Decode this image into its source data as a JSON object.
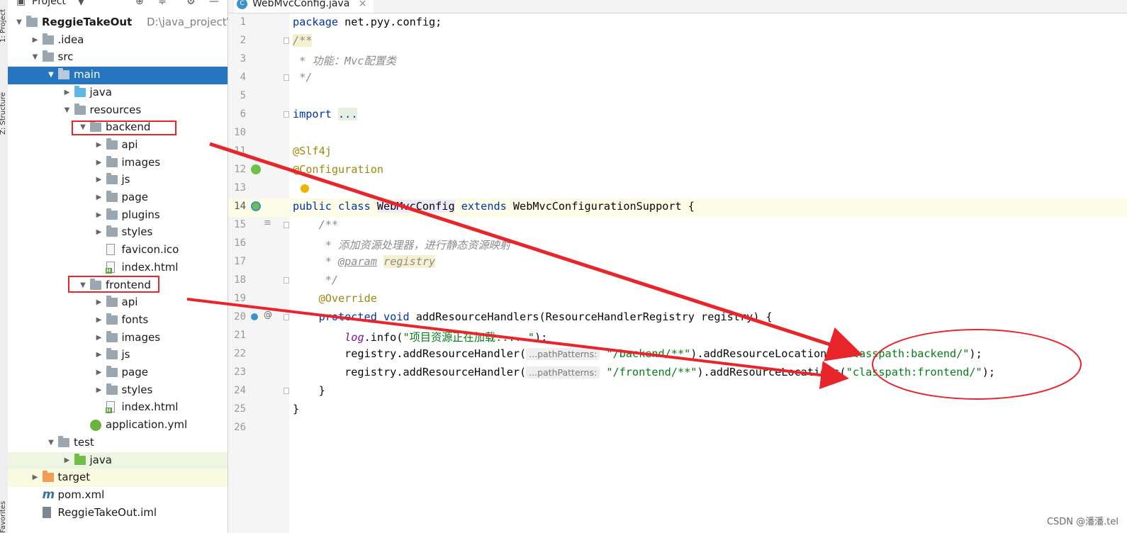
{
  "sidebar_tabs": {
    "project": "1: Project",
    "structure": "Z: Structure",
    "favorites": "Favorites"
  },
  "project_panel": {
    "header_label": "Project",
    "tree": [
      {
        "label": "ReggieTakeOut",
        "path": "D:\\java_project\\Reg",
        "bold": true,
        "icon": "module-folder",
        "expanded": true
      },
      {
        "label": ".idea",
        "icon": "folder",
        "expanded": false
      },
      {
        "label": "src",
        "icon": "folder",
        "expanded": true
      },
      {
        "label": "main",
        "icon": "folder",
        "expanded": true,
        "selected": true
      },
      {
        "label": "java",
        "icon": "source-folder",
        "expanded": false
      },
      {
        "label": "resources",
        "icon": "resources-folder",
        "expanded": true
      },
      {
        "label": "backend",
        "icon": "folder",
        "expanded": true,
        "highlighted": true
      },
      {
        "label": "api",
        "icon": "folder",
        "expanded": false
      },
      {
        "label": "images",
        "icon": "folder",
        "expanded": false
      },
      {
        "label": "js",
        "icon": "folder",
        "expanded": false
      },
      {
        "label": "page",
        "icon": "folder",
        "expanded": false
      },
      {
        "label": "plugins",
        "icon": "folder",
        "expanded": false
      },
      {
        "label": "styles",
        "icon": "folder",
        "expanded": false
      },
      {
        "label": "favicon.ico",
        "icon": "file-icon"
      },
      {
        "label": "index.html",
        "icon": "html-file-icon"
      },
      {
        "label": "frontend",
        "icon": "folder",
        "expanded": true,
        "highlighted": true
      },
      {
        "label": "api",
        "icon": "folder",
        "expanded": false
      },
      {
        "label": "fonts",
        "icon": "folder",
        "expanded": false
      },
      {
        "label": "images",
        "icon": "folder",
        "expanded": false
      },
      {
        "label": "js",
        "icon": "folder",
        "expanded": false
      },
      {
        "label": "page",
        "icon": "folder",
        "expanded": false
      },
      {
        "label": "styles",
        "icon": "folder",
        "expanded": false
      },
      {
        "label": "index.html",
        "icon": "html-file-icon"
      },
      {
        "label": "application.yml",
        "icon": "yml-file-icon"
      },
      {
        "label": "test",
        "icon": "folder",
        "expanded": true
      },
      {
        "label": "java",
        "icon": "test-source-folder",
        "expanded": false
      },
      {
        "label": "target",
        "icon": "excluded-folder",
        "expanded": false
      },
      {
        "label": "pom.xml",
        "icon": "maven-icon"
      },
      {
        "label": "ReggieTakeOut.iml",
        "icon": "iml-file-icon"
      }
    ]
  },
  "editor": {
    "tab_title": "WebMvcConfig.java",
    "tab_close": "×",
    "line_numbers": [
      "1",
      "2",
      "3",
      "4",
      "5",
      "6",
      "10",
      "11",
      "12",
      "13",
      "14",
      "15",
      "16",
      "17",
      "18",
      "19",
      "20",
      "21",
      "22",
      "23",
      "24",
      "25",
      "26"
    ],
    "code": {
      "l1_kw": "package",
      "l1_rest": " net.pyy.config;",
      "l2": "/**",
      "l3": " * 功能：Mvc配置类",
      "l4": " */",
      "l6_kw": "import",
      "l6_fold": "...",
      "l11": "@Slf4j",
      "l12": "@Configuration",
      "l14_kw1": "public class ",
      "l14_cls": "WebMvcConfig",
      "l14_kw2": " extends ",
      "l14_rest": "WebMvcConfigurationSupport {",
      "l15": "    /**",
      "l16": "     * 添加资源处理器，进行静态资源映射",
      "l17_a": "     * ",
      "l17_tag": "@param",
      "l17_b": " ",
      "l17_p": "registry",
      "l18": "     */",
      "l19": "    @Override",
      "l20_kw": "    protected void ",
      "l20_rest": "addResourceHandlers(ResourceHandlerRegistry registry) {",
      "l21_a": "        ",
      "l21_log": "log",
      "l21_b": ".info(",
      "l21_str": "\"项目资源正在加载.....\"",
      "l21_c": ");",
      "l22_a": "        registry.addResourceHandler(",
      "l22_hint": "...pathPatterns:",
      "l22_str1": " \"/backend/**\"",
      "l22_b": ").addResourceLocations(",
      "l22_str2": "\"classpath:backend/\"",
      "l22_c": ");",
      "l23_a": "        registry.addResourceHandler(",
      "l23_hint": "...pathPatterns:",
      "l23_str1": " \"/frontend/**\"",
      "l23_b": ").addResourceLocations(",
      "l23_str2": "\"classpath:frontend/\"",
      "l23_c": ");",
      "l24": "    }",
      "l25": "}"
    }
  },
  "annotation_color": "#e8252b",
  "watermark": "CSDN @潘潘.tel"
}
